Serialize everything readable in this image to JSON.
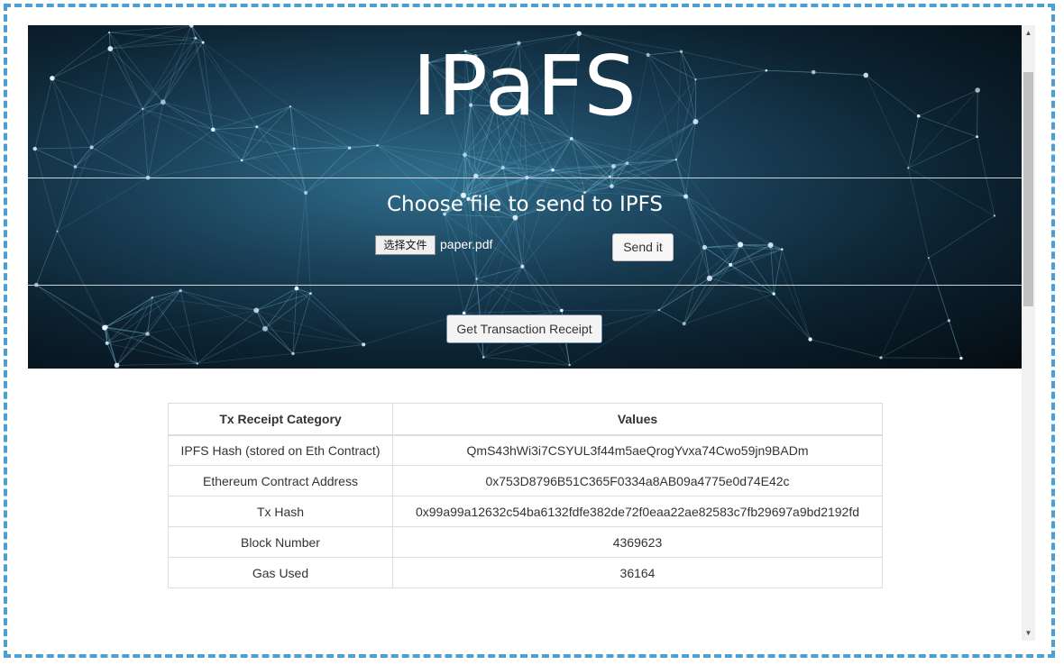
{
  "header": {
    "title": "IPaFS"
  },
  "upload": {
    "heading": "Choose file to send to IPFS",
    "choose_file_label": "选择文件",
    "file_name": "paper.pdf",
    "send_label": "Send it"
  },
  "receipt": {
    "button_label": "Get Transaction Receipt",
    "columns": [
      "Tx Receipt Category",
      "Values"
    ],
    "rows": [
      {
        "category": "IPFS Hash (stored on Eth Contract)",
        "value": "QmS43hWi3i7CSYUL3f44m5aeQrogYvxa74Cwo59jn9BADm"
      },
      {
        "category": "Ethereum Contract Address",
        "value": "0x753D8796B51C365F0334a8AB09a4775e0d74E42c"
      },
      {
        "category": "Tx Hash",
        "value": "0x99a99a12632c54ba6132fdfe382de72f0eaa22ae82583c7fb29697a9bd2192fd"
      },
      {
        "category": "Block Number",
        "value": "4369623"
      },
      {
        "category": "Gas Used",
        "value": "36164"
      }
    ]
  },
  "scrollbar": {
    "up_icon": "▲",
    "down_icon": "▼"
  },
  "colors": {
    "frame_border": "#4a9fd4",
    "hero_dark": "#050c12",
    "hero_glow": "#2f6e8c",
    "network_line": "#7fc8e6"
  }
}
